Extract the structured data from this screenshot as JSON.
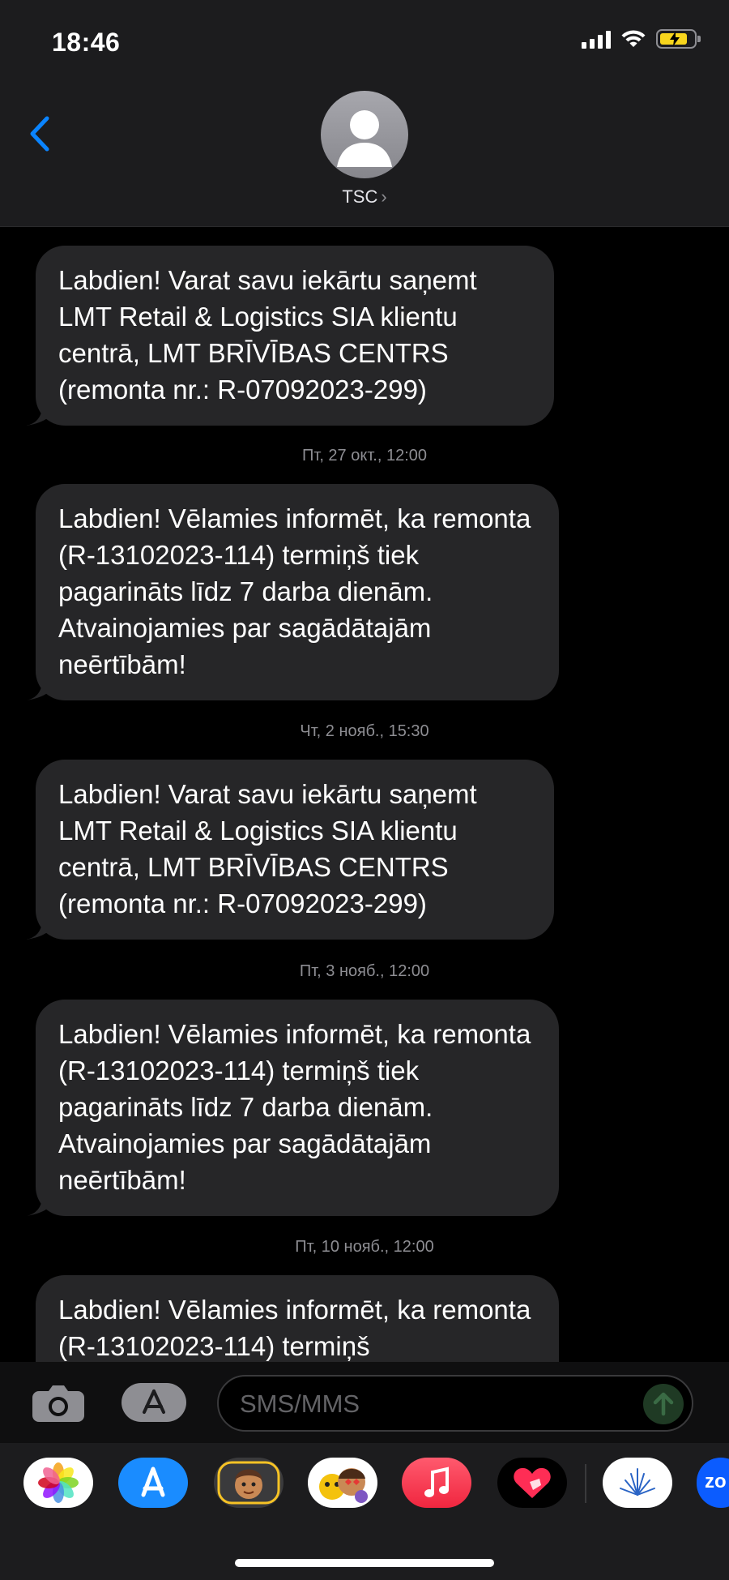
{
  "status": {
    "time": "18:46"
  },
  "header": {
    "contact_name": "TSC",
    "chevron": "›"
  },
  "messages": [
    {
      "timestamp": "",
      "text": "Labdien! Varat savu iekārtu saņemt LMT Retail & Logistics SIA klientu centrā, LMT BRĪVĪBAS CENTRS (remonta nr.: R-07092023-299)"
    },
    {
      "timestamp": "Пт, 27 окт., 12:00",
      "text": "Labdien! Vēlamies informēt, ka remonta (R-13102023-114) termiņš tiek pagarināts līdz 7 darba dienām. Atvainojamies par sagādātajām neērtībām!"
    },
    {
      "timestamp": "Чт, 2 нояб., 15:30",
      "text": "Labdien! Varat savu iekārtu saņemt LMT Retail & Logistics SIA klientu centrā, LMT BRĪVĪBAS CENTRS (remonta nr.: R-07092023-299)"
    },
    {
      "timestamp": "Пт, 3 нояб., 12:00",
      "text": "Labdien! Vēlamies informēt, ka remonta (R-13102023-114) termiņš tiek pagarināts līdz 7 darba dienām. Atvainojamies par sagādātajām neērtībām!"
    },
    {
      "timestamp": "Пт, 10 нояб., 12:00",
      "text": "Labdien! Vēlamies informēt, ka remonta (R-13102023-114) termiņš"
    }
  ],
  "composer": {
    "placeholder": "SMS/MMS"
  },
  "app_drawer": {
    "apps": [
      "photos-icon",
      "app-store-icon",
      "memoji-icon",
      "animoji-icon",
      "music-icon",
      "digital-touch-icon",
      "app-icon",
      "zoom-icon"
    ],
    "zoom_label": "zo"
  },
  "colors": {
    "bubble": "#262628",
    "header_bg": "#1c1c1e",
    "accent_blue": "#0a84ff",
    "battery_fill": "#f7d51d",
    "timestamp": "#8e8e93"
  }
}
